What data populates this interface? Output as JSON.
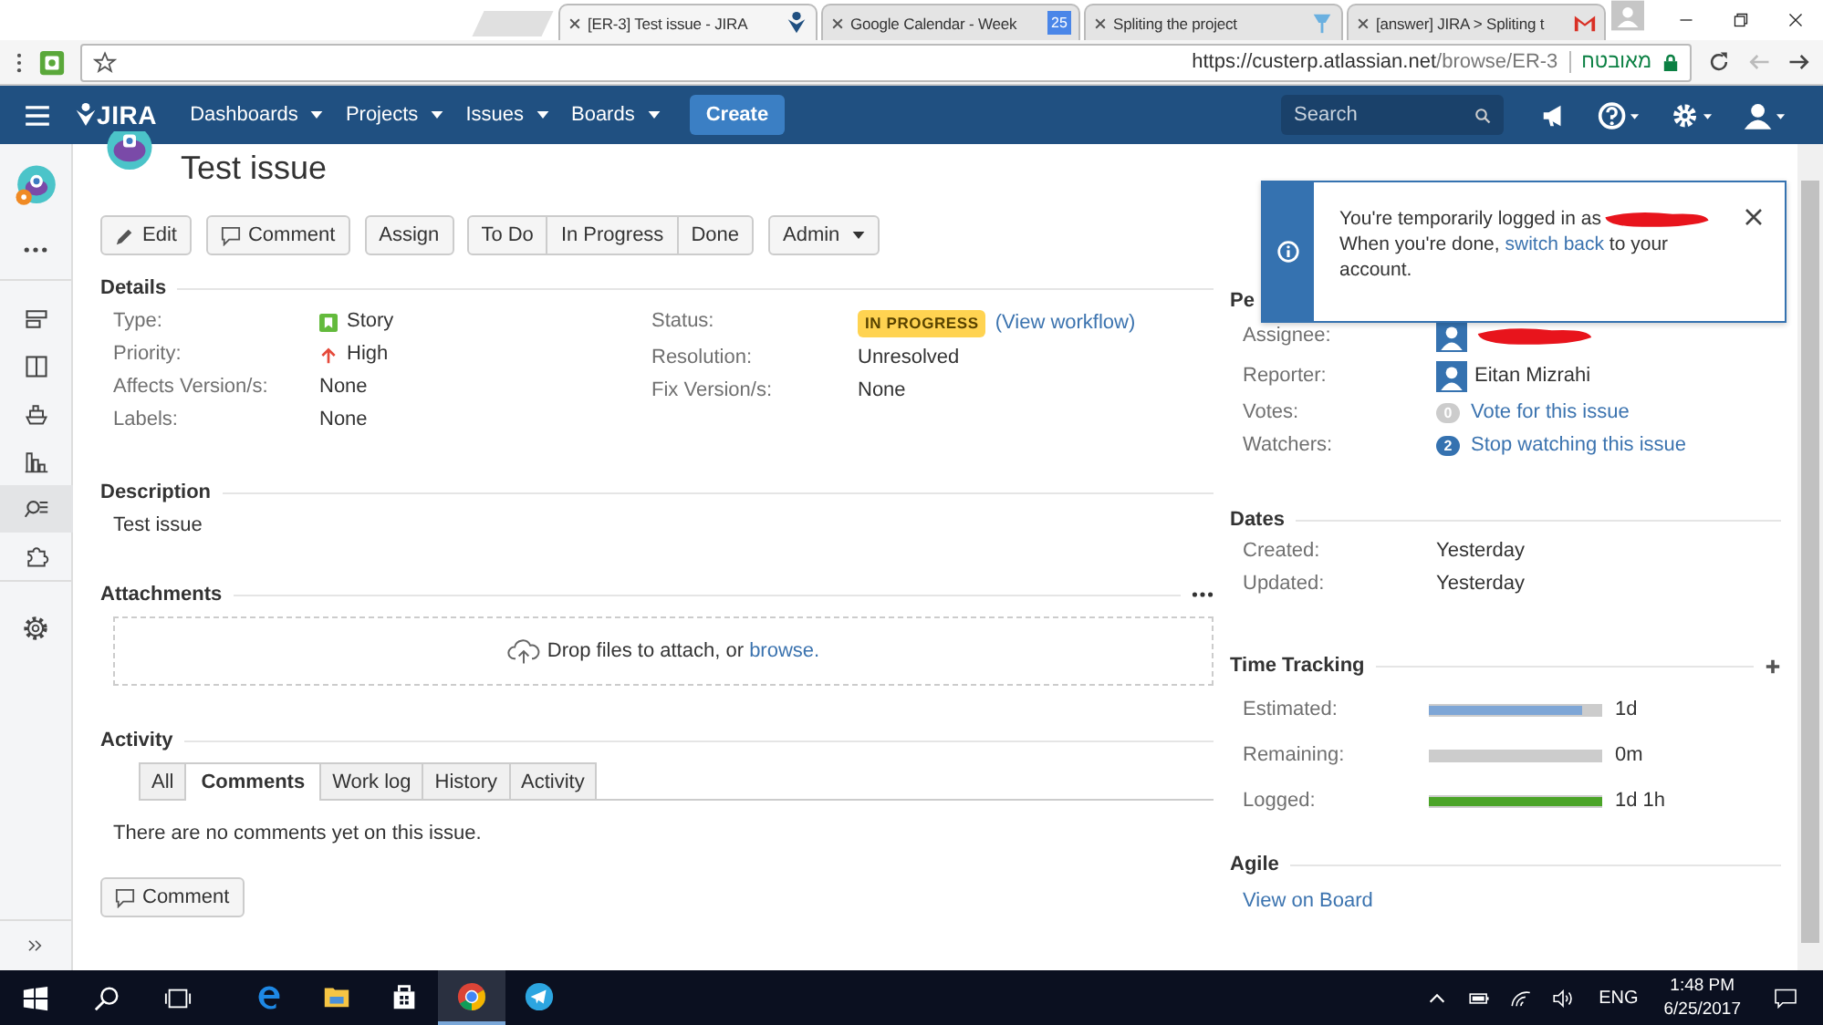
{
  "browser": {
    "tabs": [
      {
        "title": "[ER-3] Test issue - JIRA",
        "kind": "jira",
        "selected": true
      },
      {
        "title": "Google Calendar - Week",
        "kind": "calendar",
        "favicon_text": "25",
        "selected": false
      },
      {
        "title": "Spliting the project",
        "kind": "pin",
        "selected": false
      },
      {
        "title": "[answer] JIRA > Spliting t",
        "kind": "mail",
        "selected": false
      }
    ],
    "url": {
      "host": "https://custerp.atlassian.net",
      "path": "/browse/ER-3"
    },
    "secure_label": "מאובטח"
  },
  "jira_nav": {
    "logo": "JIRA",
    "menus": [
      "Dashboards",
      "Projects",
      "Issues",
      "Boards"
    ],
    "create": "Create",
    "search_placeholder": "Search"
  },
  "sidebar": {
    "items": [
      {
        "kind": "backlog",
        "selected": false
      },
      {
        "kind": "board",
        "selected": false
      },
      {
        "kind": "releases",
        "selected": false
      },
      {
        "kind": "reports",
        "selected": false
      },
      {
        "kind": "issues",
        "selected": true
      },
      {
        "kind": "addons",
        "selected": false
      }
    ]
  },
  "issue": {
    "title": "Test issue",
    "actions": [
      {
        "kind": "edit",
        "label": "Edit"
      },
      {
        "kind": "comment",
        "label": "Comment"
      },
      {
        "kind": "plain",
        "label": "Assign"
      }
    ],
    "workflow": [
      "To Do",
      "In Progress",
      "Done"
    ],
    "admin": "Admin",
    "details": {
      "heading": "Details",
      "left": [
        {
          "label": "Type:",
          "value": "Story",
          "kind": "story"
        },
        {
          "label": "Priority:",
          "value": "High",
          "kind": "priority"
        },
        {
          "label": "Affects Version/s:",
          "value": "None",
          "kind": "text"
        },
        {
          "label": "Labels:",
          "value": "None",
          "kind": "text"
        }
      ],
      "right": [
        {
          "label": "Status:",
          "kind": "status",
          "value": "IN PROGRESS",
          "link": "(View workflow)"
        },
        {
          "label": "Resolution:",
          "kind": "text",
          "value": "Unresolved"
        },
        {
          "label": "Fix Version/s:",
          "kind": "text",
          "value": "None"
        }
      ]
    },
    "description": {
      "heading": "Description",
      "text": "Test issue"
    },
    "attachments": {
      "heading": "Attachments",
      "drop_text": "Drop files to attach, or",
      "browse": "browse."
    },
    "activity": {
      "heading": "Activity",
      "tabs": [
        {
          "label": "All",
          "selected": false
        },
        {
          "label": "Comments",
          "selected": true
        },
        {
          "label": "Work log",
          "selected": false
        },
        {
          "label": "History",
          "selected": false
        },
        {
          "label": "Activity",
          "selected": false
        }
      ],
      "empty": "There are no comments yet on this issue.",
      "comment_button": "Comment"
    }
  },
  "people": {
    "heading": "Pe",
    "assignee_label": "Assignee:",
    "reporter_label": "Reporter:",
    "reporter": "Eitan Mizrahi",
    "votes_label": "Votes:",
    "votes": "0",
    "vote_link": "Vote for this issue",
    "watchers_label": "Watchers:",
    "watchers": "2",
    "watch_link": "Stop watching this issue"
  },
  "notification": {
    "text": "You're temporarily logged in as",
    "text2": "When you're done,",
    "link": "switch back",
    "text3": "to your account."
  },
  "dates": {
    "heading": "Dates",
    "rows": [
      {
        "label": "Created:",
        "value": "Yesterday"
      },
      {
        "label": "Updated:",
        "value": "Yesterday"
      }
    ]
  },
  "time_tracking": {
    "heading": "Time Tracking",
    "rows": [
      {
        "label": "Estimated:",
        "level": 0.88,
        "color": "#7ea6d6",
        "reading": "1d"
      },
      {
        "label": "Remaining:",
        "reading": "0m"
      },
      {
        "label": "Logged:",
        "level": 1,
        "color": "#4ba428",
        "reading": "1d 1h"
      }
    ]
  },
  "agile": {
    "heading": "Agile",
    "link": "View on Board"
  },
  "taskbar": {
    "apps": [
      {
        "kind": "edge",
        "selected": false
      },
      {
        "kind": "explorer",
        "selected": false
      },
      {
        "kind": "store",
        "selected": false
      },
      {
        "kind": "chrome",
        "selected": true
      },
      {
        "kind": "telegram",
        "selected": false
      }
    ],
    "language": "ENG",
    "time": "1:48 PM",
    "date": "6/25/2017"
  }
}
